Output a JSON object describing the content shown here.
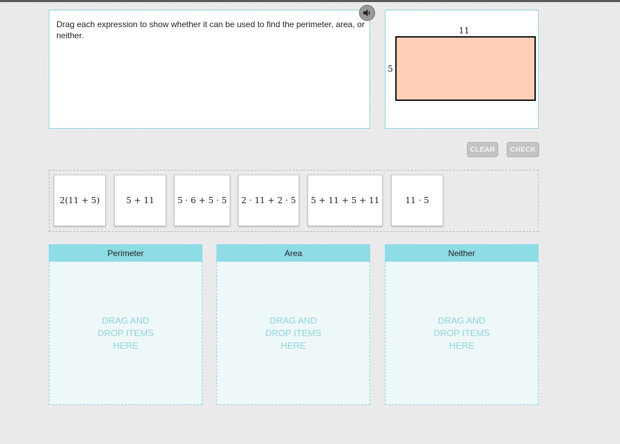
{
  "prompt": {
    "text": "Drag each expression to show whether it can be used to find the perimeter, area, or neither.",
    "audio_icon": "speaker-icon"
  },
  "figure": {
    "width_label": "11",
    "height_label": "5",
    "fill_color": "#ffcfb8",
    "stroke_color": "#111111"
  },
  "buttons": {
    "clear_label": "CLEAR",
    "check_label": "CHECK"
  },
  "tiles": [
    {
      "expression": "2(11 + 5)"
    },
    {
      "expression": "5 + 11"
    },
    {
      "expression": "5 · 6 + 5 · 5"
    },
    {
      "expression": "2 · 11 + 2 · 5"
    },
    {
      "expression": "5 + 11 + 5 + 11"
    },
    {
      "expression": "11 · 5"
    }
  ],
  "zones": [
    {
      "title": "Perimeter",
      "placeholder": [
        "DRAG AND",
        "DROP ITEMS",
        "HERE"
      ]
    },
    {
      "title": "Area",
      "placeholder": [
        "DRAG AND",
        "DROP ITEMS",
        "HERE"
      ]
    },
    {
      "title": "Neither",
      "placeholder": [
        "DRAG AND",
        "DROP ITEMS",
        "HERE"
      ]
    }
  ],
  "colors": {
    "accent": "#8edce6",
    "zone_fill": "#eef8f9",
    "button_disabled": "#c4c4c4"
  }
}
